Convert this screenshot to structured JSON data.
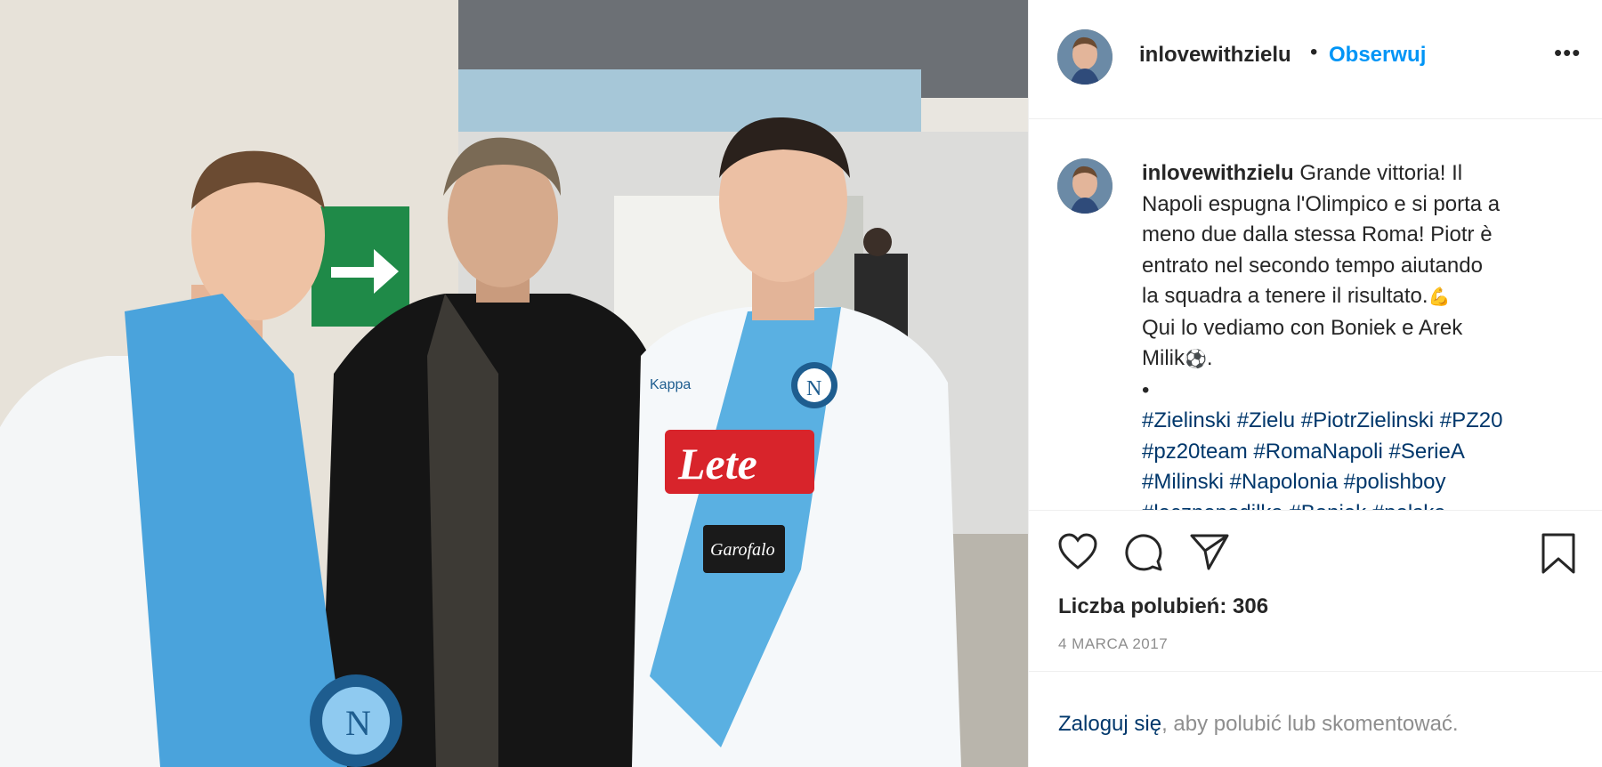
{
  "post": {
    "username": "inlovewithzielu",
    "separator": "•",
    "follow_label": "Obserwuj",
    "more_icon": "more-options-icon",
    "more_glyph": "•••",
    "photo_texts": {
      "sponsor": "Lete",
      "kit": "Kappa",
      "badge": "N",
      "brand": "Garofalo"
    }
  },
  "caption": {
    "username": "inlovewithzielu",
    "lines": [
      "Grande vittoria! Il",
      "Napoli espugna l'Olimpico e si porta a",
      "meno due dalla stessa Roma! Piotr è",
      "entrato nel secondo tempo aiutando",
      "la squadra a tenere il risultato.",
      "Qui lo vediamo con Boniek e Arek",
      "Milik",
      "."
    ],
    "emoji_muscle": "💪",
    "emoji_ball": "⚽",
    "bullet": "•",
    "tags_lines": [
      "#Zielinski #Zielu #PiotrZielinski #PZ20",
      "#pz20team #RomaNapoli #SerieA",
      "#Milinski #Napolonia #polishboy",
      "#lecznepodilka #Boniek #polska"
    ]
  },
  "actions": {
    "likes_label": "Liczba polubień: 306",
    "date": "4 MARCA 2017",
    "icons": [
      "heart-icon",
      "comment-icon",
      "share-icon",
      "bookmark-icon"
    ]
  },
  "footer": {
    "login_link": "Zaloguj się",
    "login_rest": ", aby polubić lub skomentować."
  },
  "colors": {
    "link_blue": "#0095f6",
    "hashtag": "#00376b",
    "text": "#262626",
    "muted": "#8e8e8e",
    "napoli_blue": "#4aa3dc"
  }
}
